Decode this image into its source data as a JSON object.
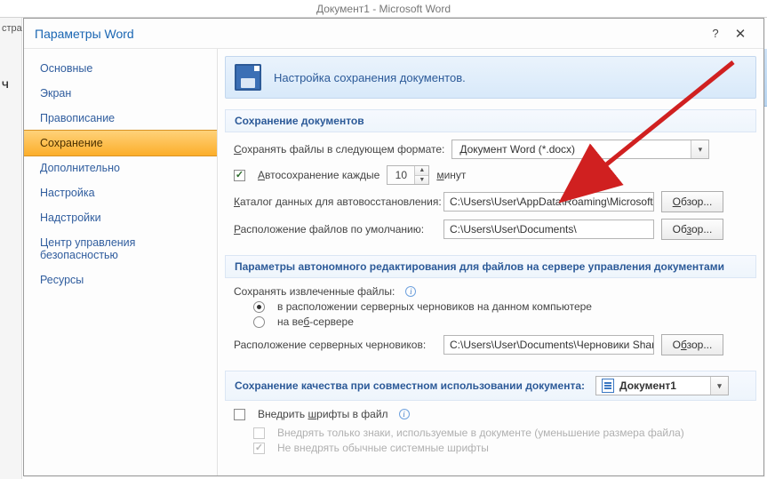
{
  "app_title": "Документ1 - Microsoft Word",
  "left_stubs": [
    "стра",
    "Ч"
  ],
  "dialog": {
    "title": "Параметры Word",
    "help": "?",
    "close": "✕"
  },
  "nav": {
    "items": [
      {
        "label": "Основные"
      },
      {
        "label": "Экран"
      },
      {
        "label": "Правописание"
      },
      {
        "label": "Сохранение",
        "selected": true
      },
      {
        "label": "Дополнительно"
      },
      {
        "label": "Настройка"
      },
      {
        "label": "Надстройки"
      },
      {
        "label": "Центр управления безопасностью"
      },
      {
        "label": "Ресурсы"
      }
    ]
  },
  "header_text": "Настройка сохранения документов.",
  "sec1": {
    "title": "Сохранение документов",
    "format_label": "Сохранять файлы в следующем формате:",
    "format_value": "Документ Word (*.docx)",
    "autosave_label": "Автосохранение каждые",
    "autosave_value": "10",
    "autosave_unit": "минут",
    "recovery_label": "Каталог данных для автовосстановления:",
    "recovery_path": "C:\\Users\\User\\AppData\\Roaming\\Microsoft\\W",
    "default_label": "Расположение файлов по умолчанию:",
    "default_path": "C:\\Users\\User\\Documents\\",
    "browse1": "Обзор...",
    "browse2": "Обзор..."
  },
  "sec2": {
    "title": "Параметры автономного редактирования для файлов на сервере управления документами",
    "save_extracted": "Сохранять извлеченные файлы:",
    "opt1": "в расположении серверных черновиков на данном компьютере",
    "opt2": "на веб-сервере",
    "drafts_label": "Расположение серверных черновиков:",
    "drafts_path": "C:\\Users\\User\\Documents\\Черновики SharePo",
    "browse": "Обзор..."
  },
  "sec3": {
    "title": "Сохранение качества при совместном использовании документа:",
    "doc_name": "Документ1",
    "embed": "Внедрить шрифты в файл",
    "sub1": "Внедрять только знаки, используемые в документе (уменьшение размера файла)",
    "sub2": "Не внедрять обычные системные шрифты"
  }
}
